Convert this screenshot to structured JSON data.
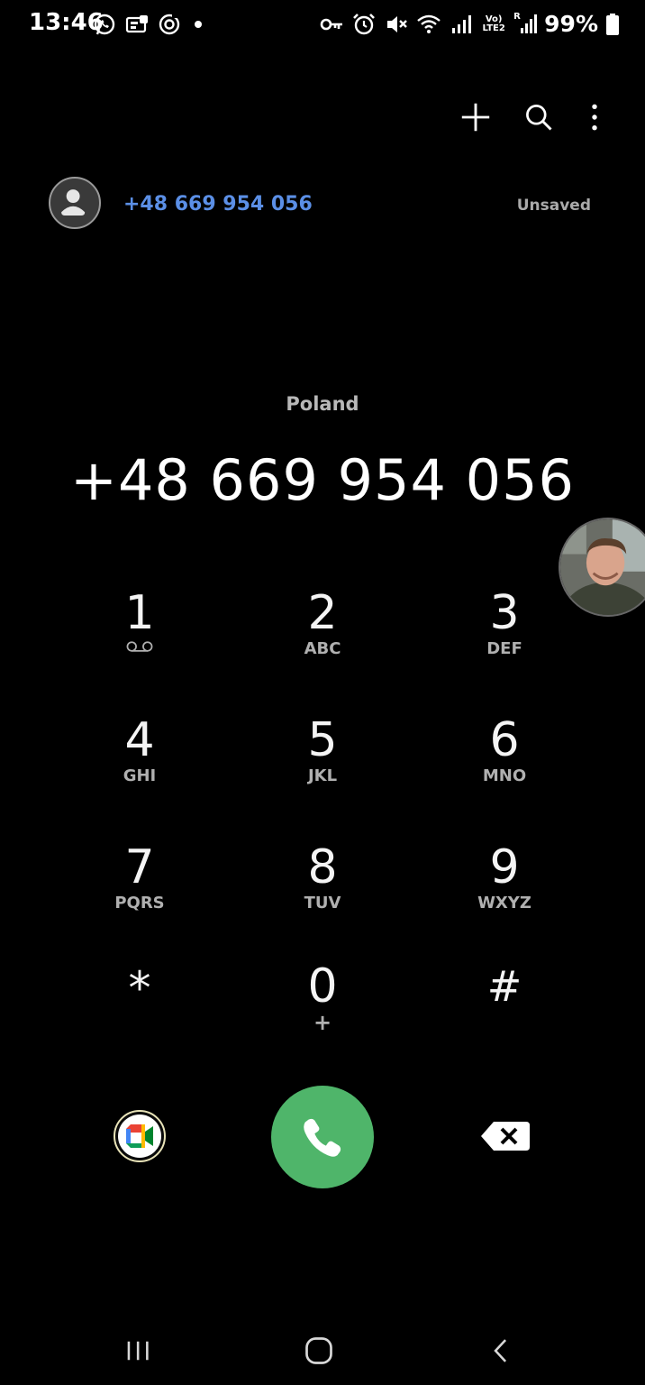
{
  "status_bar": {
    "time": "13:46",
    "left_icons": [
      "whatsapp-icon",
      "notification-card-icon",
      "sync-icon",
      "dot-icon"
    ],
    "right_icons": [
      "vpn-key-icon",
      "alarm-icon",
      "mute-icon",
      "wifi-icon",
      "signal-icon",
      "volte-lte2-icon",
      "roaming-signal-icon"
    ],
    "volte_label": "Vo)",
    "lte_label": "LTE2",
    "roaming_label": "R",
    "battery": "99%"
  },
  "toolbar": {
    "add_icon": "plus-icon",
    "search_icon": "search-icon",
    "more_icon": "more-vert-icon"
  },
  "suggestion": {
    "number": "+48 669 954 056",
    "status": "Unsaved"
  },
  "dialer": {
    "country": "Poland",
    "number": "+48 669 954 056"
  },
  "keypad": [
    {
      "digit": "1",
      "letters": ""
    },
    {
      "digit": "2",
      "letters": "ABC"
    },
    {
      "digit": "3",
      "letters": "DEF"
    },
    {
      "digit": "4",
      "letters": "GHI"
    },
    {
      "digit": "5",
      "letters": "JKL"
    },
    {
      "digit": "6",
      "letters": "MNO"
    },
    {
      "digit": "7",
      "letters": "PQRS"
    },
    {
      "digit": "8",
      "letters": "TUV"
    },
    {
      "digit": "9",
      "letters": "WXYZ"
    },
    {
      "digit": "*",
      "letters": ""
    },
    {
      "digit": "0",
      "letters": "+"
    },
    {
      "digit": "#",
      "letters": ""
    }
  ],
  "colors": {
    "call_button": "#4fb56a",
    "suggest_number": "#5b8fe6",
    "background": "#000000"
  }
}
